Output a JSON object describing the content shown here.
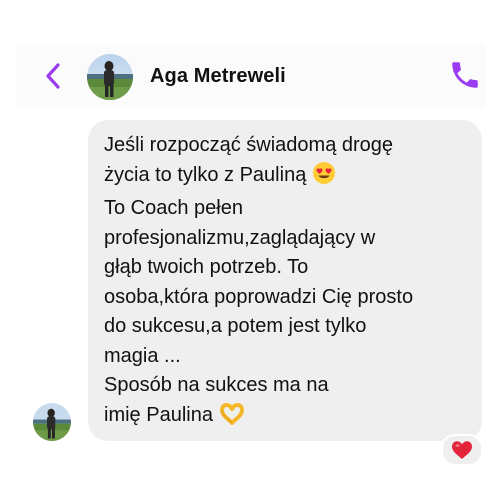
{
  "header": {
    "contact_name": "Aga Metreweli",
    "back_icon": "chevron-left-icon",
    "call_icon": "phone-icon",
    "accent_color": "#9b3cf2"
  },
  "message": {
    "bubble_color": "#efefef",
    "lines": [
      "Jeśli rozpocząć świadomą drogę",
      "życia to tylko z Pauliną",
      "To Coach pełen",
      "profesjonalizmu,zaglądający w",
      "głąb twoich potrzeb. To",
      "osoba,która poprowadzi Cię prosto",
      "do sukcesu,a potem jest tylko",
      "magia ...",
      "Sposób na sukces ma na",
      "imię Paulina"
    ],
    "emoji_line_2": "heart-eyes-emoji",
    "emoji_line_10": "heart-hands-emoji",
    "reaction": "red-heart-icon"
  }
}
